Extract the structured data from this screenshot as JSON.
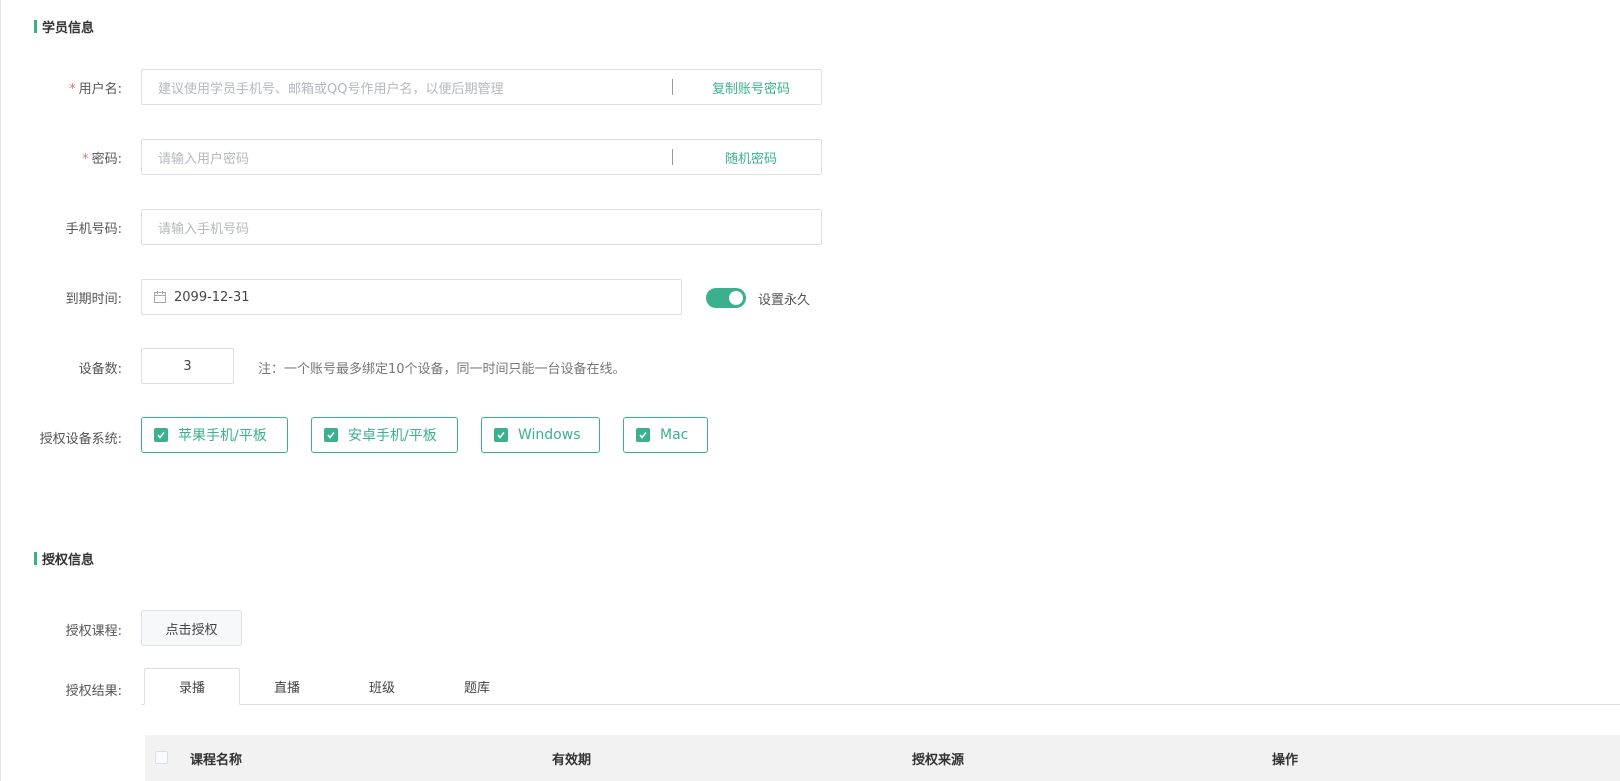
{
  "student_section": {
    "title": "学员信息",
    "username": {
      "label": "用户名:",
      "required": true,
      "placeholder": "建议使用学员手机号、邮箱或QQ号作用户名，以便后期管理",
      "suffix_button": "复制账号密码"
    },
    "password": {
      "label": "密码:",
      "required": true,
      "placeholder": "请输入用户密码",
      "suffix_button": "随机密码"
    },
    "phone": {
      "label": "手机号码:",
      "placeholder": "请输入手机号码"
    },
    "expiry": {
      "label": "到期时间:",
      "value": "2099-12-31",
      "icon": "calendar-icon",
      "permanent_label": "设置永久",
      "permanent_on": true
    },
    "devices": {
      "label": "设备数:",
      "value": "3",
      "note": "注：一个账号最多绑定10个设备，同一时间只能一台设备在线。"
    },
    "os": {
      "label": "授权设备系统:",
      "options": [
        {
          "label": "苹果手机/平板",
          "checked": true
        },
        {
          "label": "安卓手机/平板",
          "checked": true
        },
        {
          "label": "Windows",
          "checked": true
        },
        {
          "label": "Mac",
          "checked": true
        }
      ]
    }
  },
  "auth_section": {
    "title": "授权信息",
    "course_label": "授权课程:",
    "grant_button": "点击授权",
    "result_label": "授权结果:",
    "tabs": [
      "录播",
      "直播",
      "班级",
      "题库"
    ],
    "active_tab": "录播",
    "table_headers": [
      "课程名称",
      "有效期",
      "授权来源",
      "操作"
    ]
  },
  "colors": {
    "accent": "#3bb08f",
    "required": "#f56c6c"
  }
}
